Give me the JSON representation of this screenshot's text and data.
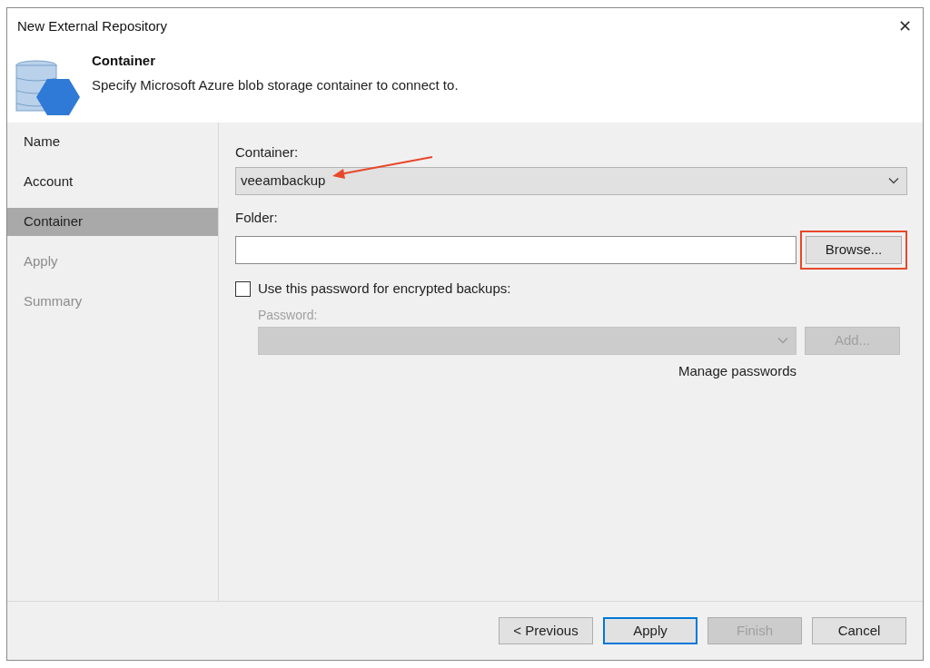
{
  "window": {
    "title": "New External Repository",
    "close": "✕"
  },
  "header": {
    "title": "Container",
    "description": "Specify Microsoft Azure blob storage container to connect to."
  },
  "steps": [
    {
      "label": "Name",
      "selected": false,
      "disabled": false
    },
    {
      "label": "Account",
      "selected": false,
      "disabled": false
    },
    {
      "label": "Container",
      "selected": true,
      "disabled": false
    },
    {
      "label": "Apply",
      "selected": false,
      "disabled": true
    },
    {
      "label": "Summary",
      "selected": false,
      "disabled": true
    }
  ],
  "container": {
    "label": "Container:",
    "value": "veeambackup",
    "annotated": true
  },
  "folder": {
    "label": "Folder:",
    "browse": "Browse...",
    "browse_highlighted": true
  },
  "encryption": {
    "label": "Use this password for encrypted backups:",
    "checked": false,
    "password_label": "Password:",
    "add": "Add...",
    "manage": "Manage passwords"
  },
  "buttons": [
    {
      "label": "< Previous",
      "disabled": false,
      "default": false
    },
    {
      "label": "Apply",
      "disabled": false,
      "default": true
    },
    {
      "label": "Finish",
      "disabled": true,
      "default": false
    },
    {
      "label": "Cancel",
      "disabled": false,
      "default": false
    }
  ]
}
